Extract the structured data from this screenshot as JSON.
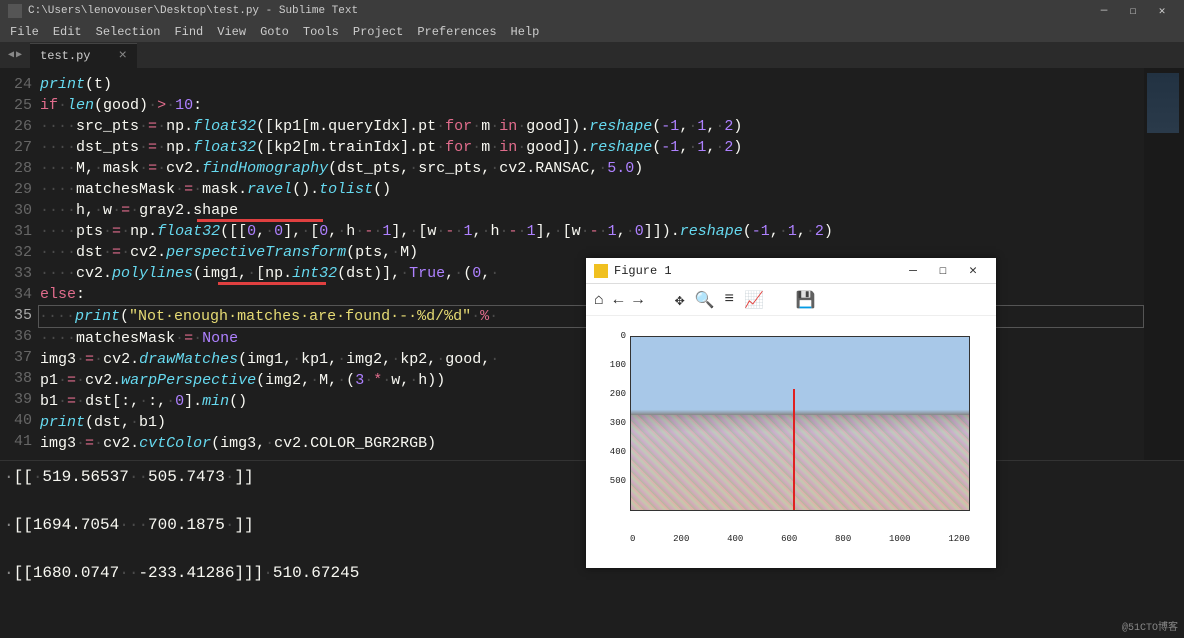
{
  "window": {
    "title": "C:\\Users\\lenovouser\\Desktop\\test.py - Sublime Text",
    "min": "—",
    "max": "☐",
    "close": "✕"
  },
  "menu": [
    "File",
    "Edit",
    "Selection",
    "Find",
    "View",
    "Goto",
    "Tools",
    "Project",
    "Preferences",
    "Help"
  ],
  "tab": {
    "name": "test.py",
    "close": "×"
  },
  "nav": {
    "left": "◀",
    "right": "▶"
  },
  "gutter": [
    "24",
    "25",
    "26",
    "27",
    "28",
    "29",
    "30",
    "31",
    "32",
    "33",
    "34",
    "35",
    "36",
    "37",
    "38",
    "39",
    "40",
    "41"
  ],
  "console": {
    "l1": "[[ 519.56537  505.7473 ]]",
    "l2": "[[1694.7054   700.1875 ]]",
    "l3": "[[1680.0747  -233.41286]]] 510.67245"
  },
  "figure": {
    "title": "Figure 1",
    "min": "—",
    "max": "☐",
    "close": "✕",
    "tools": {
      "home": "⌂",
      "back": "←",
      "fwd": "→",
      "pan": "✥",
      "zoom": "🔍",
      "cfg": "≡",
      "axis": "📈",
      "save": "💾"
    },
    "yticks": [
      "0",
      "100",
      "200",
      "300",
      "400",
      "500"
    ],
    "xticks": [
      "0",
      "200",
      "400",
      "600",
      "800",
      "1000",
      "1200"
    ]
  },
  "chart_data": {
    "type": "heatmap",
    "title": "",
    "xlim": [
      0,
      1300
    ],
    "ylim": [
      0,
      530
    ],
    "xlabel": "",
    "ylabel": "",
    "note": "stitched panorama output with red polyline near x≈560"
  },
  "watermark": "@51CTO博客",
  "code": {
    "l24": [
      "print",
      "(t)"
    ],
    "l25": [
      "if",
      " ",
      "len",
      "(good) ",
      ">",
      " ",
      "10",
      ":"
    ],
    "l26a": "    src_pts ",
    "l26op": "=",
    "l26b": " np.",
    "l26fn": "float32",
    "l26c": "([kp1[m.queryIdx].pt ",
    "l26for": "for",
    "l26d": " m ",
    "l26in": "in",
    "l26e": " good]).",
    "l26r": "reshape",
    "l26f": "(",
    "l26n1": "-1",
    "l26g": ", ",
    "l26n2": "1",
    "l26h": ", ",
    "l26n3": "2",
    "l26i": ")",
    "l27a": "    dst_pts ",
    "l27op": "=",
    "l27b": " np.",
    "l27fn": "float32",
    "l27c": "([kp2[m.trainIdx].pt ",
    "l27for": "for",
    "l27d": " m ",
    "l27in": "in",
    "l27e": " good]).",
    "l27r": "reshape",
    "l27f": "(",
    "l27n1": "-1",
    "l27g": ", ",
    "l27n2": "1",
    "l27h": ", ",
    "l27n3": "2",
    "l27i": ")",
    "l28": "    M, mask = cv2.findHomography(dst_pts, src_pts, cv2.RANSAC, 5.0)",
    "l29": "    matchesMask = mask.ravel().tolist()",
    "l30": "    h, w = gray2.shape",
    "l31": "    pts = np.float32([[0, 0], [0, h - 1], [w - 1, h - 1], [w - 1, 0]]).reshape(-1, 1, 2)",
    "l32": "    dst = cv2.perspectiveTransform(pts, M)",
    "l33": "    cv2.polylines(img1, [np.int32(dst)], True, (0, ",
    "l34": "else:",
    "l35": "    print(\"Not enough matches are found - %d/%d\" % ",
    "l36": "    matchesMask = None",
    "l37": "img3 = cv2.drawMatches(img1, kp1, img2, kp2, good, ",
    "l38": "p1 = cv2.warpPerspective(img2, M, (3 * w, h))",
    "l39": "b1 = dst[:, :, 0].min()",
    "l40": "print(dst, b1)",
    "l41": "img3 = cv2.cvtColor(img3, cv2.COLOR_BGR2RGB)"
  }
}
